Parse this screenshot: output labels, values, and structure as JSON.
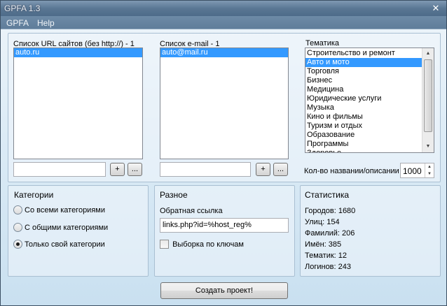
{
  "window": {
    "title": "GPFA 1.3"
  },
  "menu": [
    "GPFA",
    "Help"
  ],
  "urls": {
    "label": "Список URL сайтов (без http://) - 1",
    "items": [
      "auto.ru"
    ],
    "input_value": "",
    "add_label": "+",
    "browse_label": "..."
  },
  "emails": {
    "label": "Список e-mail - 1",
    "items": [
      "auto@mail.ru"
    ],
    "input_value": "",
    "add_label": "+",
    "browse_label": "..."
  },
  "themes": {
    "label": "Тематика",
    "items": [
      "Строительство и ремонт",
      "Авто и мото",
      "Торговля",
      "Бизнес",
      "Медицина",
      "Юридические услуги",
      "Музыка",
      "Кино и фильмы",
      "Туризм и отдых",
      "Образование",
      "Программы",
      "Здоровье"
    ],
    "selected_index": 1,
    "count_label": "Кол-во названии/описании",
    "count_value": "1000"
  },
  "categories": {
    "title": "Категории",
    "options": [
      "Со всеми категориями",
      "С общими категориями",
      "Только свой категории"
    ],
    "selected_index": 2
  },
  "misc": {
    "title": "Разное",
    "backlink_label": "Обратная ссылка",
    "backlink_value": "links.php?id=%host_reg%",
    "keyword_checkbox_label": "Выборка по ключам",
    "keyword_checked": false
  },
  "stats": {
    "title": "Статистика",
    "lines": [
      "Городов: 1680",
      "Улиц: 154",
      "Фамилий: 206",
      "Имён: 385",
      "Тематик: 12",
      "Логинов: 243"
    ]
  },
  "create_button": "Создать проект!"
}
